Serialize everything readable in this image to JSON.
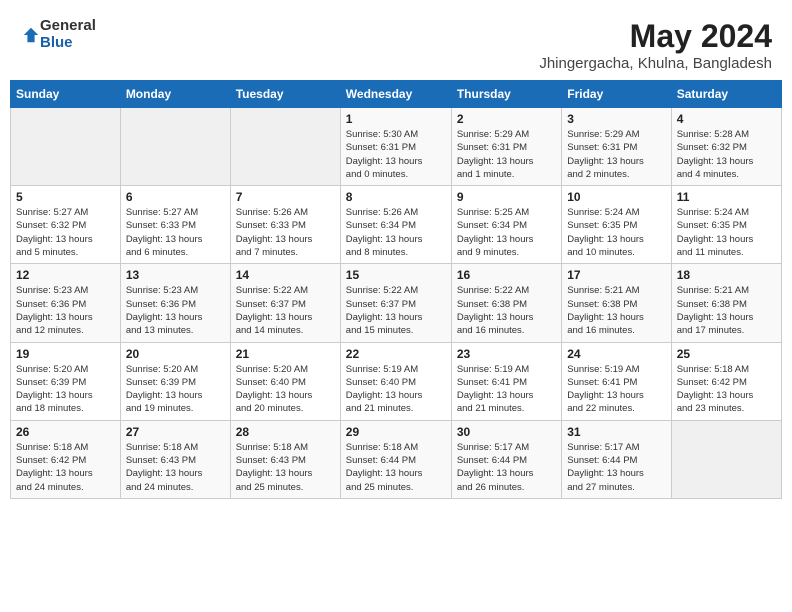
{
  "logo": {
    "general": "General",
    "blue": "Blue"
  },
  "title": "May 2024",
  "location": "Jhingergacha, Khulna, Bangladesh",
  "days_of_week": [
    "Sunday",
    "Monday",
    "Tuesday",
    "Wednesday",
    "Thursday",
    "Friday",
    "Saturday"
  ],
  "weeks": [
    [
      {
        "day": "",
        "info": ""
      },
      {
        "day": "",
        "info": ""
      },
      {
        "day": "",
        "info": ""
      },
      {
        "day": "1",
        "info": "Sunrise: 5:30 AM\nSunset: 6:31 PM\nDaylight: 13 hours\nand 0 minutes."
      },
      {
        "day": "2",
        "info": "Sunrise: 5:29 AM\nSunset: 6:31 PM\nDaylight: 13 hours\nand 1 minute."
      },
      {
        "day": "3",
        "info": "Sunrise: 5:29 AM\nSunset: 6:31 PM\nDaylight: 13 hours\nand 2 minutes."
      },
      {
        "day": "4",
        "info": "Sunrise: 5:28 AM\nSunset: 6:32 PM\nDaylight: 13 hours\nand 4 minutes."
      }
    ],
    [
      {
        "day": "5",
        "info": "Sunrise: 5:27 AM\nSunset: 6:32 PM\nDaylight: 13 hours\nand 5 minutes."
      },
      {
        "day": "6",
        "info": "Sunrise: 5:27 AM\nSunset: 6:33 PM\nDaylight: 13 hours\nand 6 minutes."
      },
      {
        "day": "7",
        "info": "Sunrise: 5:26 AM\nSunset: 6:33 PM\nDaylight: 13 hours\nand 7 minutes."
      },
      {
        "day": "8",
        "info": "Sunrise: 5:26 AM\nSunset: 6:34 PM\nDaylight: 13 hours\nand 8 minutes."
      },
      {
        "day": "9",
        "info": "Sunrise: 5:25 AM\nSunset: 6:34 PM\nDaylight: 13 hours\nand 9 minutes."
      },
      {
        "day": "10",
        "info": "Sunrise: 5:24 AM\nSunset: 6:35 PM\nDaylight: 13 hours\nand 10 minutes."
      },
      {
        "day": "11",
        "info": "Sunrise: 5:24 AM\nSunset: 6:35 PM\nDaylight: 13 hours\nand 11 minutes."
      }
    ],
    [
      {
        "day": "12",
        "info": "Sunrise: 5:23 AM\nSunset: 6:36 PM\nDaylight: 13 hours\nand 12 minutes."
      },
      {
        "day": "13",
        "info": "Sunrise: 5:23 AM\nSunset: 6:36 PM\nDaylight: 13 hours\nand 13 minutes."
      },
      {
        "day": "14",
        "info": "Sunrise: 5:22 AM\nSunset: 6:37 PM\nDaylight: 13 hours\nand 14 minutes."
      },
      {
        "day": "15",
        "info": "Sunrise: 5:22 AM\nSunset: 6:37 PM\nDaylight: 13 hours\nand 15 minutes."
      },
      {
        "day": "16",
        "info": "Sunrise: 5:22 AM\nSunset: 6:38 PM\nDaylight: 13 hours\nand 16 minutes."
      },
      {
        "day": "17",
        "info": "Sunrise: 5:21 AM\nSunset: 6:38 PM\nDaylight: 13 hours\nand 16 minutes."
      },
      {
        "day": "18",
        "info": "Sunrise: 5:21 AM\nSunset: 6:38 PM\nDaylight: 13 hours\nand 17 minutes."
      }
    ],
    [
      {
        "day": "19",
        "info": "Sunrise: 5:20 AM\nSunset: 6:39 PM\nDaylight: 13 hours\nand 18 minutes."
      },
      {
        "day": "20",
        "info": "Sunrise: 5:20 AM\nSunset: 6:39 PM\nDaylight: 13 hours\nand 19 minutes."
      },
      {
        "day": "21",
        "info": "Sunrise: 5:20 AM\nSunset: 6:40 PM\nDaylight: 13 hours\nand 20 minutes."
      },
      {
        "day": "22",
        "info": "Sunrise: 5:19 AM\nSunset: 6:40 PM\nDaylight: 13 hours\nand 21 minutes."
      },
      {
        "day": "23",
        "info": "Sunrise: 5:19 AM\nSunset: 6:41 PM\nDaylight: 13 hours\nand 21 minutes."
      },
      {
        "day": "24",
        "info": "Sunrise: 5:19 AM\nSunset: 6:41 PM\nDaylight: 13 hours\nand 22 minutes."
      },
      {
        "day": "25",
        "info": "Sunrise: 5:18 AM\nSunset: 6:42 PM\nDaylight: 13 hours\nand 23 minutes."
      }
    ],
    [
      {
        "day": "26",
        "info": "Sunrise: 5:18 AM\nSunset: 6:42 PM\nDaylight: 13 hours\nand 24 minutes."
      },
      {
        "day": "27",
        "info": "Sunrise: 5:18 AM\nSunset: 6:43 PM\nDaylight: 13 hours\nand 24 minutes."
      },
      {
        "day": "28",
        "info": "Sunrise: 5:18 AM\nSunset: 6:43 PM\nDaylight: 13 hours\nand 25 minutes."
      },
      {
        "day": "29",
        "info": "Sunrise: 5:18 AM\nSunset: 6:44 PM\nDaylight: 13 hours\nand 25 minutes."
      },
      {
        "day": "30",
        "info": "Sunrise: 5:17 AM\nSunset: 6:44 PM\nDaylight: 13 hours\nand 26 minutes."
      },
      {
        "day": "31",
        "info": "Sunrise: 5:17 AM\nSunset: 6:44 PM\nDaylight: 13 hours\nand 27 minutes."
      },
      {
        "day": "",
        "info": ""
      }
    ]
  ]
}
